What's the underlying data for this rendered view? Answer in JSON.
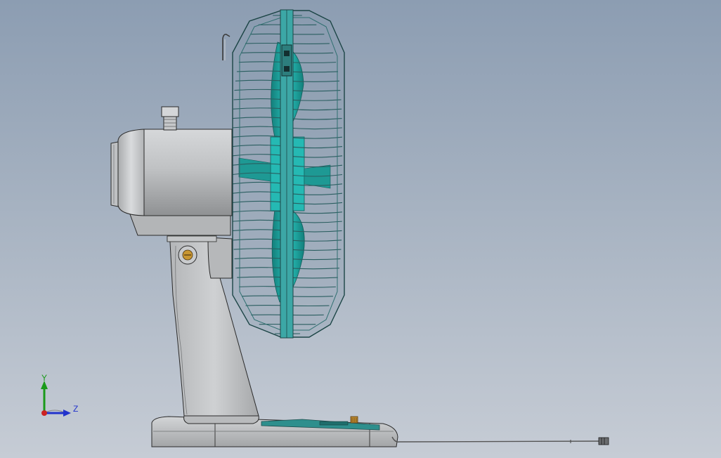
{
  "viewport": {
    "background_top": "#8c9db2",
    "background_bottom": "#c6ccd5"
  },
  "model": {
    "name": "desk-fan-side-view",
    "colors": {
      "body": "#c2c4c6",
      "body_dark": "#8e9092",
      "body_edge": "#2a2a2a",
      "grille": "#2f6f70",
      "grille_frame": "#3ca7a6",
      "blade": "#1fb5b0",
      "knob": "#b8862e"
    }
  },
  "triad": {
    "y_label": "Y",
    "z_label": "Z",
    "y_color": "#1a9a1a",
    "z_color": "#2233cc",
    "x_color": "#cc2222"
  }
}
